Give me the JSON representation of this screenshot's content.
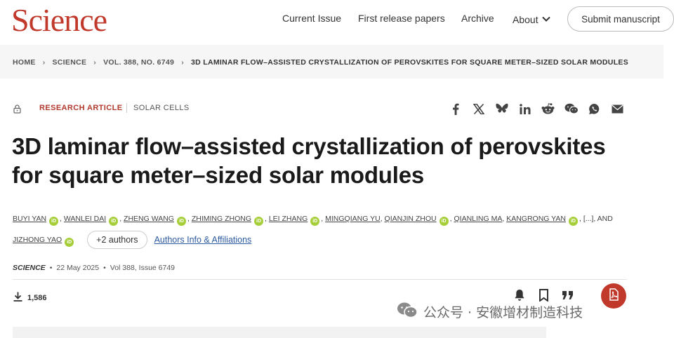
{
  "header": {
    "logo": "Science",
    "nav": {
      "current_issue": "Current Issue",
      "first_release": "First release papers",
      "archive": "Archive",
      "about": "About"
    },
    "submit": "Submit manuscript"
  },
  "breadcrumb": {
    "items": [
      "HOME",
      "SCIENCE",
      "VOL. 388, NO. 6749",
      "3D LAMINAR FLOW–ASSISTED CRYSTALLIZATION OF PEROVSKITES FOR SQUARE METER–SIZED SOLAR MODULES"
    ]
  },
  "article": {
    "type": "RESEARCH ARTICLE",
    "subject": "SOLAR CELLS",
    "title_line1": "3D laminar flow–assisted crystallization of perovskites",
    "title_line2": "for square meter–sized solar modules",
    "authors": [
      "BUYI YAN",
      "WANLEI DAI",
      "ZHENG WANG",
      "ZHIMING ZHONG",
      "LEI ZHANG",
      "MINGQIANG YU",
      "QIANJIN ZHOU",
      "QIANLING MA",
      "KANGRONG YAN"
    ],
    "ellipsis": "[...]",
    "and": ", AND",
    "last_author": "JIZHONG YAO",
    "more_authors": "+2 authors",
    "affiliations": "Authors Info & Affiliations",
    "orcid_label": "iD",
    "journal": "SCIENCE",
    "date": "22 May 2025",
    "volume": "Vol 388, Issue 6749",
    "downloads": "1,586"
  },
  "share_icons": [
    "facebook-icon",
    "x-icon",
    "bluesky-icon",
    "linkedin-icon",
    "reddit-icon",
    "wechat-icon",
    "whatsapp-icon",
    "email-icon"
  ],
  "watermark": "公众号 · 安徽增材制造科技",
  "colors": {
    "brand": "#c0392b",
    "link": "#2c5aa0",
    "orcid": "#a6ce39"
  }
}
